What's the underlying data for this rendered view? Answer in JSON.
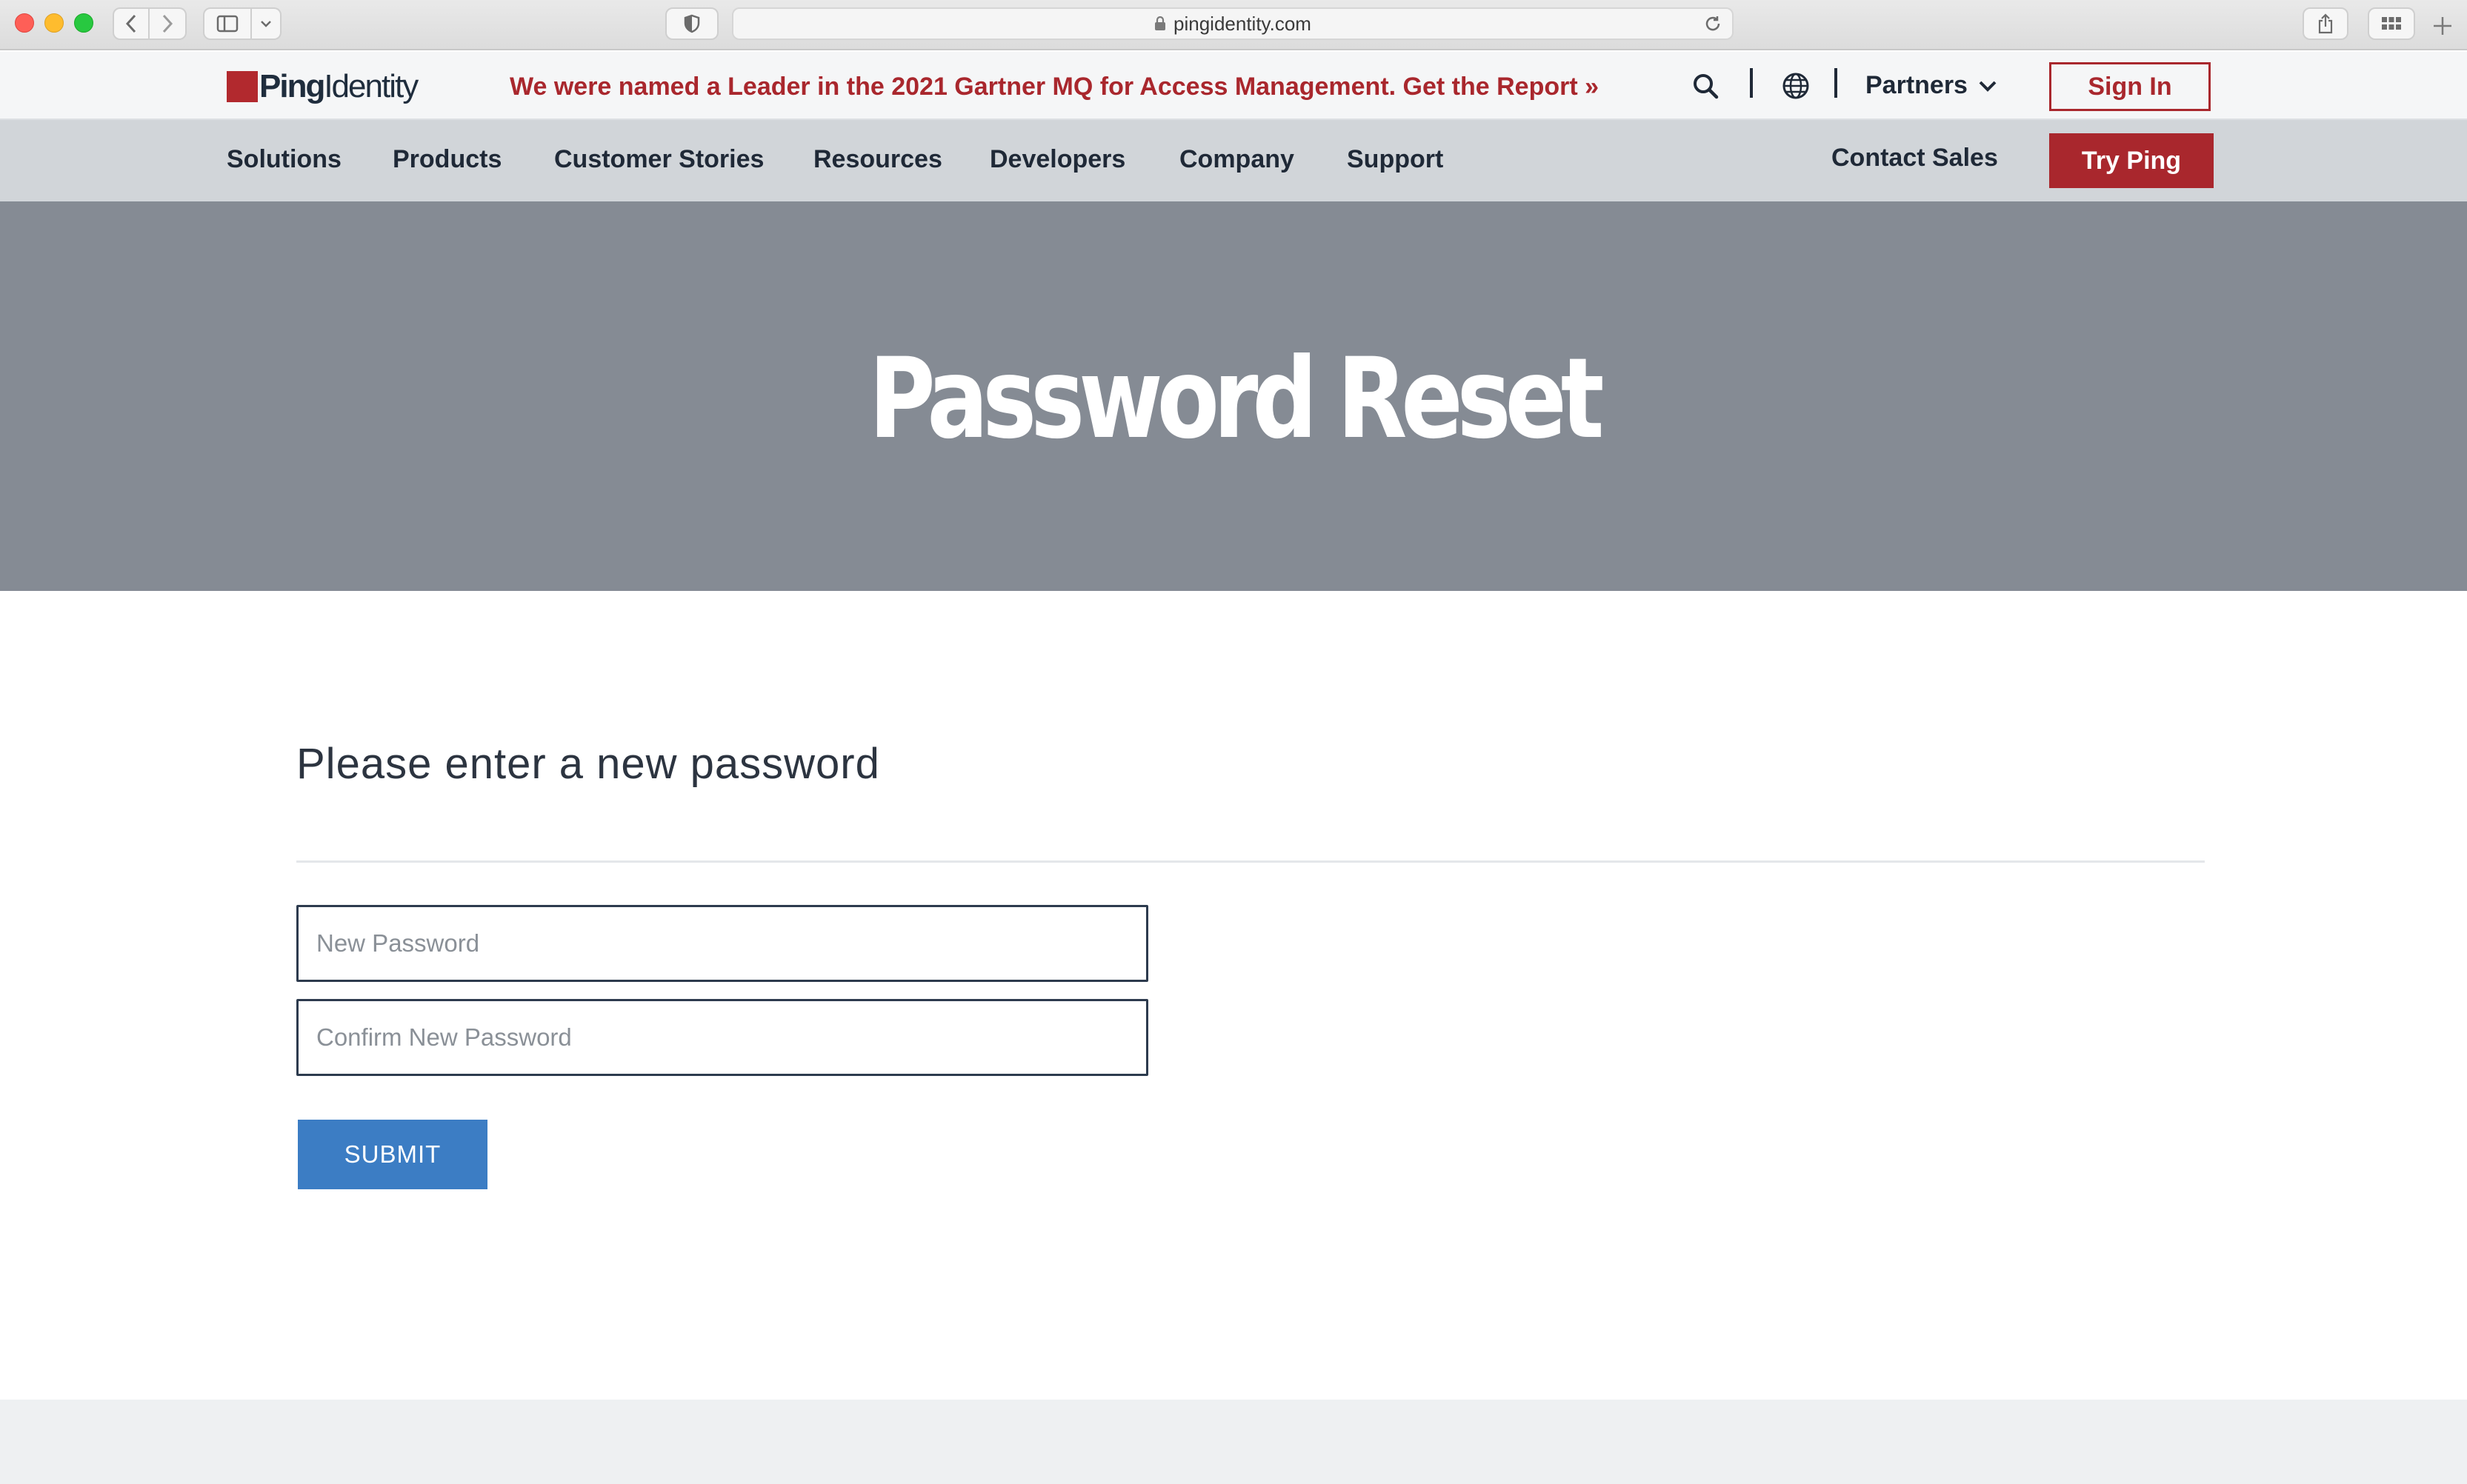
{
  "browser": {
    "url": "pingidentity.com"
  },
  "header": {
    "logo_bold": "Ping",
    "logo_light": "Identity",
    "announcement": "We were named a Leader in the 2021 Gartner MQ for Access Management. Get the Report »",
    "partners_label": "Partners",
    "signin_label": "Sign In"
  },
  "nav": {
    "items": [
      {
        "label": "Solutions"
      },
      {
        "label": "Products"
      },
      {
        "label": "Customer Stories"
      },
      {
        "label": "Resources"
      },
      {
        "label": "Developers"
      },
      {
        "label": "Company"
      },
      {
        "label": "Support"
      }
    ],
    "contact_sales": "Contact Sales",
    "try_ping": "Try Ping"
  },
  "hero": {
    "title": "Password Reset"
  },
  "form": {
    "prompt": "Please enter a new password",
    "new_password_placeholder": "New Password",
    "confirm_password_placeholder": "Confirm New Password",
    "submit_label": "SUBMIT"
  },
  "colors": {
    "brand_red": "#a9272d",
    "hero_bg": "#858b94",
    "nav_bg": "#d1d5d9",
    "submit_blue": "#3c7dc4"
  }
}
